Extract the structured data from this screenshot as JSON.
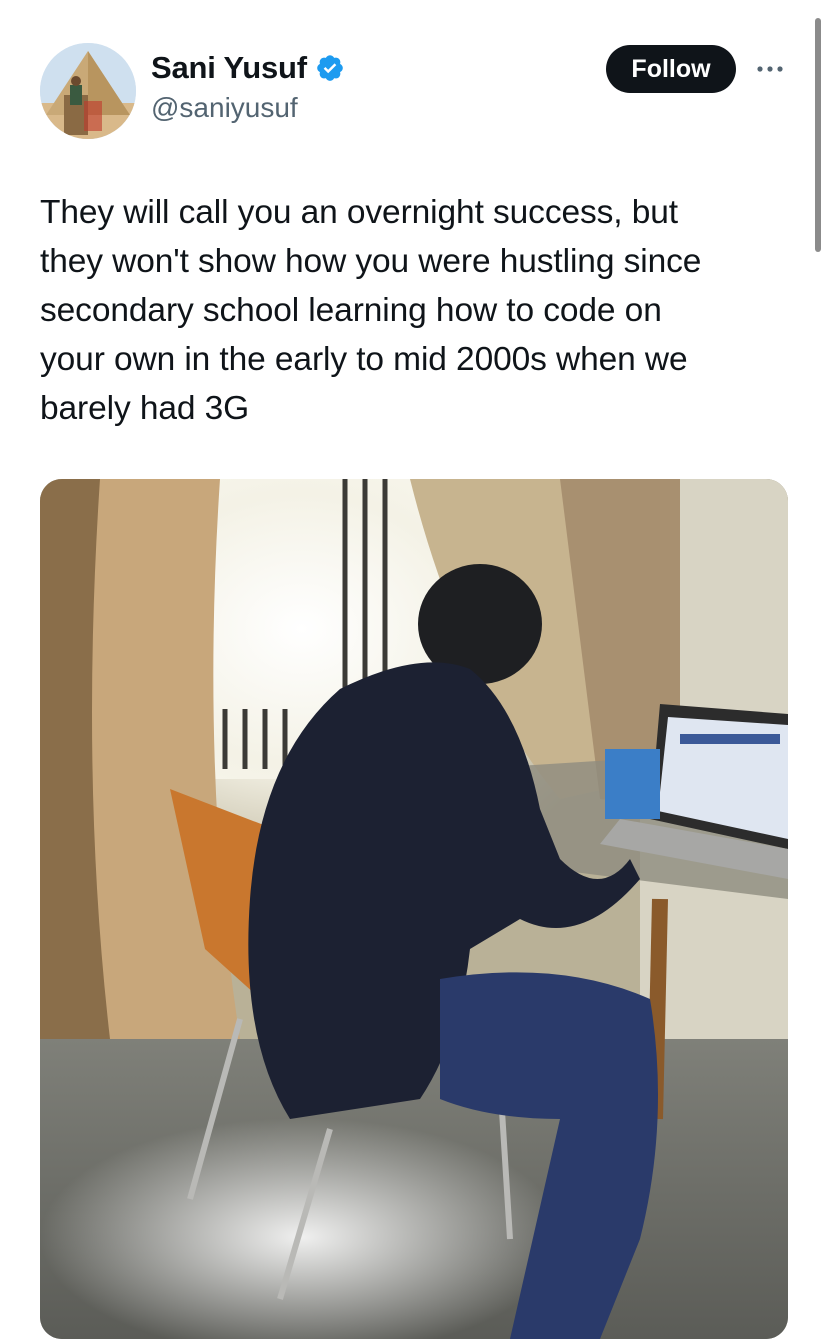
{
  "author": {
    "display_name": "Sani Yusuf",
    "handle": "@saniyusuf",
    "verified": true,
    "avatar_icon": "avatar-pyramid-camel-photo"
  },
  "actions": {
    "follow_label": "Follow",
    "more_icon": "more-horizontal-icon"
  },
  "tweet": {
    "text": "They will call you an overnight success, but\nthey won't show how you were hustling since\nsecondary school learning how to code on\nyour own in the early to mid 2000s when we\nbarely had 3G"
  },
  "media": {
    "type": "photo"
  },
  "colors": {
    "follow_bg": "#0f1419",
    "verified_badge": "#1d9bf0",
    "handle_text": "#536471"
  }
}
